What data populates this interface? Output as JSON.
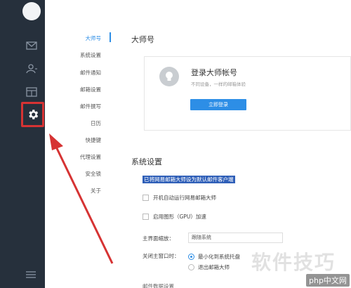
{
  "nav": {
    "items": [
      {
        "label": "大师号",
        "active": true
      },
      {
        "label": "系统设置"
      },
      {
        "label": "邮件通知"
      },
      {
        "label": "邮箱设置"
      },
      {
        "label": "邮件撰写"
      },
      {
        "label": "日历"
      },
      {
        "label": "快捷键"
      },
      {
        "label": "代理设置"
      },
      {
        "label": "安全锁"
      },
      {
        "label": "关于"
      }
    ]
  },
  "master": {
    "section_title": "大师号",
    "card_title": "登录大师帐号",
    "card_sub": "不同设备，一样的邮箱体验",
    "login_button": "立即登录"
  },
  "system": {
    "section_title": "系统设置",
    "highlight_text": "已将网易邮箱大师设为默认邮件客户端",
    "auto_start": "开机自动运行网易邮箱大师",
    "gpu_accel": "启用图形（GPU）加速",
    "zoom_label": "主界面缩放：",
    "zoom_value": "跟随系统",
    "close_label": "关闭主窗口时：",
    "close_opt1": "最小化到系统托盘",
    "close_opt2": "退出邮箱大师",
    "more_label": "邮件数据设置"
  },
  "watermark": {
    "big": "软件技巧",
    "php": "php中文网"
  },
  "colors": {
    "rail": "#26303c",
    "accent": "#2d8ee6",
    "highlight_box": "#d63333"
  }
}
